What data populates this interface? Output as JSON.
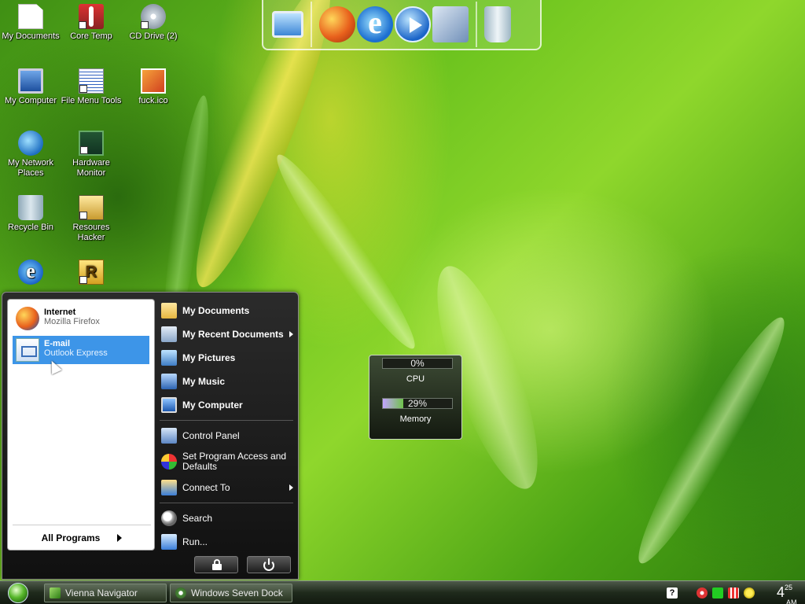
{
  "desktop_icons": [
    {
      "label": "My Documents",
      "icon": "document-icon"
    },
    {
      "label": "Core Temp",
      "icon": "thermometer-icon"
    },
    {
      "label": "CD Drive (2)",
      "icon": "cd-drive-icon"
    },
    {
      "label": "My Computer",
      "icon": "computer-icon"
    },
    {
      "label": "File Menu Tools",
      "icon": "file-tools-icon"
    },
    {
      "label": "fuck.ico",
      "icon": "image-file-icon"
    },
    {
      "label": "My Network Places",
      "icon": "network-icon"
    },
    {
      "label": "Hardware Monitor",
      "icon": "hardware-monitor-icon"
    },
    {
      "label": "Recycle Bin",
      "icon": "recycle-bin-icon"
    },
    {
      "label": "Resoures Hacker",
      "icon": "resource-hacker-icon"
    },
    {
      "label": "",
      "icon": "internet-explorer-icon"
    },
    {
      "label": "",
      "icon": "r-app-icon"
    }
  ],
  "dock": {
    "items": [
      "computer-icon",
      "firefox-icon",
      "internet-explorer-icon",
      "media-player-icon",
      "tools-icon",
      "recycle-bin-icon"
    ]
  },
  "start_menu": {
    "pinned": [
      {
        "title": "Internet",
        "subtitle": "Mozilla Firefox",
        "icon": "firefox-icon",
        "selected": false
      },
      {
        "title": "E-mail",
        "subtitle": "Outlook Express",
        "icon": "mail-icon",
        "selected": true
      }
    ],
    "all_programs": "All Programs",
    "right_items": [
      {
        "label": "My Documents",
        "icon": "folder-icon",
        "bold": true,
        "submenu": false
      },
      {
        "label": "My Recent Documents",
        "icon": "recent-documents-icon",
        "bold": true,
        "submenu": true
      },
      {
        "label": "My Pictures",
        "icon": "pictures-icon",
        "bold": true,
        "submenu": false
      },
      {
        "label": "My Music",
        "icon": "music-icon",
        "bold": true,
        "submenu": false
      },
      {
        "label": "My Computer",
        "icon": "computer-icon",
        "bold": true,
        "submenu": false
      },
      {
        "label": "Control Panel",
        "icon": "control-panel-icon",
        "bold": false,
        "submenu": false
      },
      {
        "label": "Set Program Access and Defaults",
        "icon": "program-access-icon",
        "bold": false,
        "submenu": false
      },
      {
        "label": "Connect To",
        "icon": "connect-icon",
        "bold": false,
        "submenu": true
      },
      {
        "label": "Search",
        "icon": "search-icon",
        "bold": false,
        "submenu": false
      },
      {
        "label": "Run...",
        "icon": "run-icon",
        "bold": false,
        "submenu": false
      }
    ],
    "buttons": [
      "lock-icon",
      "power-icon"
    ]
  },
  "gadget": {
    "cpu_label": "CPU",
    "cpu_value": "0%",
    "cpu_fraction": 0.0,
    "memory_label": "Memory",
    "memory_value": "29%",
    "memory_fraction": 0.29
  },
  "taskbar": {
    "buttons": [
      {
        "label": "Vienna Navigator",
        "icon": "vienna-icon"
      },
      {
        "label": "Windows Seven Dock",
        "icon": "dock-app-icon"
      }
    ],
    "tray": {
      "help": "?",
      "icons": [
        "security-alert-icon",
        "check-icon",
        "network-status-icon",
        "messenger-icon"
      ]
    },
    "clock": {
      "hour": "4",
      "minute": "25",
      "ampm": "AM"
    }
  },
  "colors": {
    "selection": "#3d95e8",
    "menu_dark": "#1a1a1a",
    "wallpaper_green": "#6cc31e"
  }
}
